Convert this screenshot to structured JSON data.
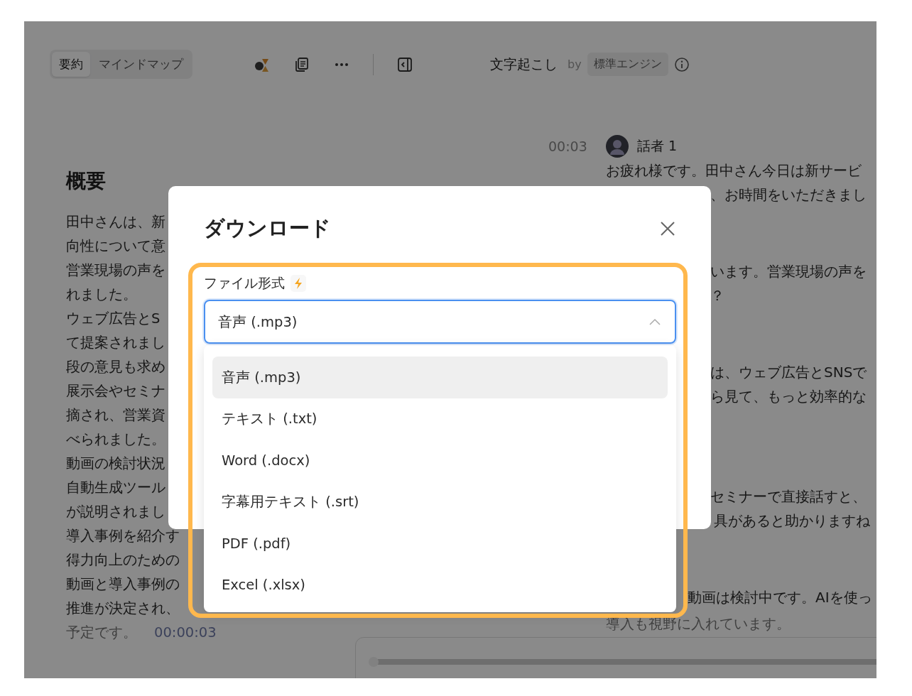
{
  "toolbar": {
    "tabs": [
      {
        "label": "要約",
        "selected": true
      },
      {
        "label": "マインドマップ",
        "selected": false
      }
    ],
    "title": "文字起こし",
    "by": "by",
    "engine": "標準エンジン"
  },
  "summary": {
    "heading": "概要",
    "lines": [
      "田中さんは、新",
      "向性について意",
      "営業現場の声を",
      "れました。",
      "ウェブ広告とS",
      "て提案されまし",
      "段の意見も求め",
      "展示会やセミナ",
      "摘され、営業資",
      "べられました。",
      "動画の検討状況",
      "自動生成ツール",
      "が説明されまし",
      "導入事例を紹介す",
      "得力向上のための",
      "動画と導入事例の",
      "推進が決定され、"
    ],
    "last_line": {
      "text": "予定です。",
      "time": "00:00:03"
    }
  },
  "transcript": {
    "time": "00:03",
    "speaker": "話者 1",
    "paragraphs": [
      {
        "lines": [
          {
            "kind": "full",
            "text": "お疲れ様です。田中さん今日は新サービ"
          },
          {
            "kind": "after-dialog",
            "text": "、お時間をいただきまし"
          }
        ]
      },
      {
        "lines": [
          {
            "kind": "after-dialog",
            "text": "います。営業現場の声を"
          },
          {
            "kind": "after-dialog",
            "text": "？"
          }
        ]
      },
      {
        "lines": [
          {
            "kind": "after-dialog",
            "text": "は、ウェブ広告とSNSで"
          },
          {
            "kind": "after-dialog",
            "text": "ら見て、もっと効率的な"
          }
        ]
      },
      {
        "lines": [
          {
            "kind": "after-dialog",
            "text": "セミナーで直接話すと、"
          },
          {
            "kind": "after-frame",
            "text": "具があると助かりますね"
          }
        ]
      },
      {
        "lines": [
          {
            "kind": "after-frame",
            "text": "動画は検討中です。AIを使っ"
          },
          {
            "kind": "faded",
            "text": "導入も視野に入れています。"
          }
        ]
      }
    ]
  },
  "player": {
    "progress_visible": true
  },
  "dialog": {
    "title": "ダウンロード",
    "field_label": "ファイル形式",
    "value": "音声 (.mp3)",
    "expanded": true,
    "options": [
      {
        "label": "音声 (.mp3)",
        "selected": true
      },
      {
        "label": "テキスト (.txt)",
        "selected": false
      },
      {
        "label": "Word (.docx)",
        "selected": false
      },
      {
        "label": "字幕用テキスト (.srt)",
        "selected": false
      },
      {
        "label": "PDF (.pdf)",
        "selected": false
      },
      {
        "label": "Excel (.xlsx)",
        "selected": false
      }
    ]
  }
}
